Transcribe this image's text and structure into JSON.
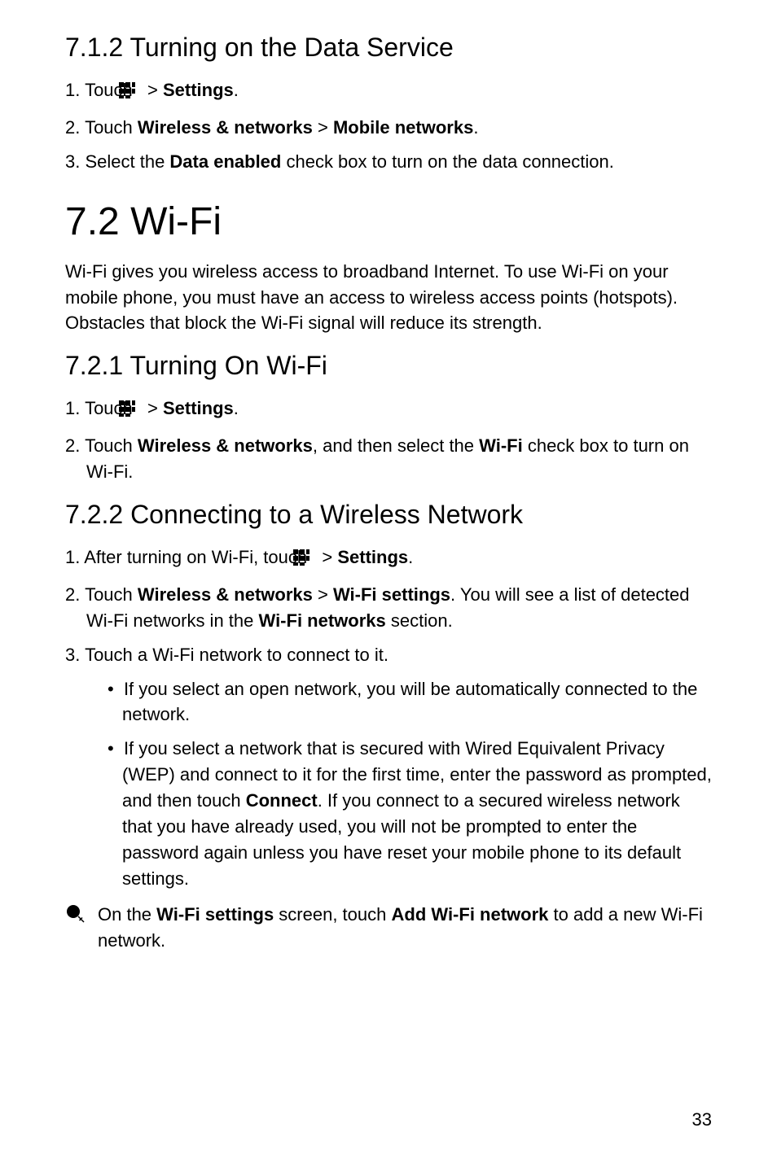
{
  "sec_7_1_2": {
    "title": "7.1.2  Turning on the Data Service",
    "step1_a": "1. Touch ",
    "step1_b": " > ",
    "step1_c": "Settings",
    "step1_d": ".",
    "step2_a": "2. Touch ",
    "step2_b": "Wireless & networks",
    "step2_c": " > ",
    "step2_d": "Mobile networks",
    "step2_e": ".",
    "step3_a": "3. Select the ",
    "step3_b": "Data enabled",
    "step3_c": " check box to turn on the data connection."
  },
  "sec_7_2": {
    "title": "7.2  Wi-Fi",
    "para": "Wi-Fi gives you wireless access to broadband Internet. To use Wi-Fi on your mobile phone, you must have an access to wireless access points (hotspots). Obstacles that block the Wi-Fi signal will reduce its strength."
  },
  "sec_7_2_1": {
    "title": "7.2.1  Turning On Wi-Fi",
    "step1_a": "1. Touch ",
    "step1_b": " > ",
    "step1_c": "Settings",
    "step1_d": ".",
    "step2_a": "2. Touch ",
    "step2_b": "Wireless & networks",
    "step2_c": ", and then select the ",
    "step2_d": "Wi-Fi",
    "step2_e": " check box to turn on Wi-Fi."
  },
  "sec_7_2_2": {
    "title": "7.2.2  Connecting to a Wireless Network",
    "step1_a": "1. After turning on Wi-Fi, touch ",
    "step1_b": " > ",
    "step1_c": "Settings",
    "step1_d": ".",
    "step2_a": "2. Touch ",
    "step2_b": "Wireless & networks",
    "step2_c": " > ",
    "step2_d": "Wi-Fi settings",
    "step2_e": ". You will see a list of detected Wi-Fi networks in the ",
    "step2_f": "Wi-Fi networks",
    "step2_g": " section.",
    "step3": "3. Touch a Wi-Fi network to connect to it.",
    "bullet1": "If you select an open network, you will be automatically connected to the network.",
    "bullet2_a": "If you select a network that is secured with Wired Equivalent Privacy (WEP) and connect to it for the first time, enter the password as prompted, and then touch ",
    "bullet2_b": "Connect",
    "bullet2_c": ". If you connect to a secured wireless network that you have already used, you will not be prompted to enter the password again unless you have reset your mobile phone to its default settings.",
    "tip_a": "On the ",
    "tip_b": "Wi-Fi settings",
    "tip_c": " screen, touch ",
    "tip_d": "Add Wi-Fi network",
    "tip_e": " to add a new Wi-Fi network."
  },
  "page_number": "33",
  "icons": {
    "apps": "apps-grid-icon",
    "tip": "tip-icon"
  }
}
